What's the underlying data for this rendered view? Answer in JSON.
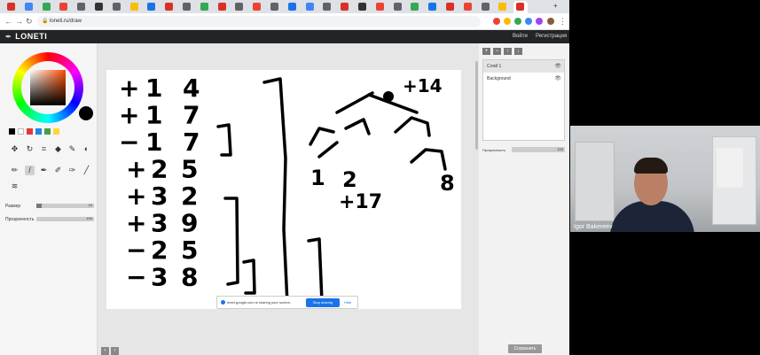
{
  "browser": {
    "url": "loneti.ru/draw",
    "tab_colors": [
      "#d93025",
      "#4285f4",
      "#34a853",
      "#ea4335",
      "#5f6368",
      "#333333",
      "#5f6368",
      "#fbbc04",
      "#1a73e8",
      "#d93025",
      "#5f6368",
      "#34a853",
      "#d93025",
      "#5f6368",
      "#ea4335",
      "#5f6368",
      "#1a73e8",
      "#4285f4",
      "#5f6368",
      "#d93025",
      "#333333",
      "#ea4335",
      "#5f6368",
      "#34a853",
      "#1a73e8",
      "#d93025",
      "#ea4335",
      "#5f6368",
      "#fbbc04",
      "#d93025"
    ],
    "new_tab_symbol": "+"
  },
  "app": {
    "logo": "LONETI",
    "header_links": [
      "Войти",
      "Регистрация"
    ]
  },
  "tools": {
    "current_color": "#000000",
    "swatches": [
      "#000000",
      "#ffffff",
      "#e53935",
      "#1e88e5",
      "#43a047",
      "#fdd835"
    ],
    "size_label": "Размер",
    "size_value": "10",
    "opacity_label": "Прозрачность",
    "opacity_value": "100"
  },
  "canvas": {
    "left_column": [
      {
        "sign": "+",
        "a": "1",
        "b": "4"
      },
      {
        "sign": "+",
        "a": "1",
        "b": "7"
      },
      {
        "sign": "−",
        "a": "1",
        "b": "7"
      },
      {
        "sign": "+",
        "a": "2",
        "b": "5"
      },
      {
        "sign": "+",
        "a": "3",
        "b": "2"
      },
      {
        "sign": "+",
        "a": "3",
        "b": "9"
      },
      {
        "sign": "−",
        "a": "2",
        "b": "5"
      },
      {
        "sign": "−",
        "a": "3",
        "b": "8"
      }
    ],
    "tree_root": "+14",
    "tree_leaf_left": "1",
    "tree_leaf_mid": "2",
    "tree_leaf_right": "8",
    "tree_sub": "+17"
  },
  "share_bar": {
    "text": "meet.google.com is sharing your screen.",
    "stop": "Stop sharing",
    "hide": "Hide"
  },
  "layers": {
    "items": [
      {
        "name": "Слой 1"
      },
      {
        "name": "Background"
      }
    ],
    "opacity_label": "Прозрачность",
    "opacity_value": "100",
    "save": "Сохранить"
  },
  "webcam": {
    "participant": "Igor Bakereev"
  }
}
